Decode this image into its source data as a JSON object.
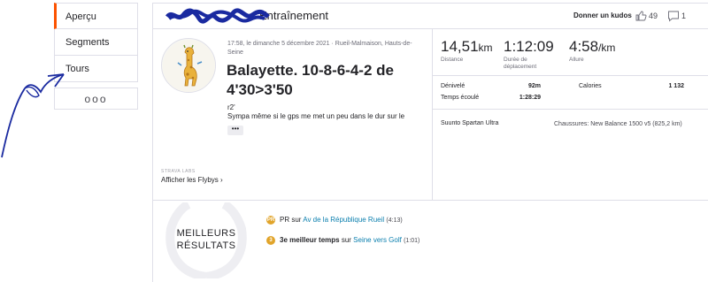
{
  "nav": {
    "items": [
      {
        "label": "Aperçu",
        "active": true
      },
      {
        "label": "Segments",
        "active": false
      },
      {
        "label": "Tours",
        "active": false
      }
    ],
    "more_label": "ooo"
  },
  "header": {
    "title": "Entraînement",
    "kudos_label": "Donner un kudos",
    "kudos_count": "49",
    "comment_count": "1"
  },
  "activity": {
    "meta": "17:58, le dimanche 5 décembre 2021 · Rueil-Malmaison, Hauts-de-Seine",
    "title": "Balayette. 10-8-6-4-2 de 4'30>3'50",
    "desc_line1": "r2'",
    "desc_line2": "Sympa même si le gps me met un peu dans le dur sur le",
    "more_btn": "•••",
    "labs_label": "STRAVA LABS",
    "flyby_label": "Afficher les Flybys ›"
  },
  "stats": {
    "distance": {
      "value": "14,51",
      "unit": "km",
      "label": "Distance"
    },
    "duration": {
      "value": "1:12:09",
      "label": "Durée de déplacement"
    },
    "pace": {
      "value": "4:58",
      "unit": "/km",
      "label": "Allure"
    },
    "elevation_label": "Dénivelé",
    "elevation_value": "92m",
    "elapsed_label": "Temps écoulé",
    "elapsed_value": "1:28:29",
    "calories_label": "Calories",
    "calories_value": "1 132",
    "device": "Suunto Spartan Ultra",
    "shoes": "Chaussures: New Balance 1500 v5 (825,2 km)"
  },
  "best": {
    "title": "MEILLEURS RÉSULTATS",
    "efforts": [
      {
        "medal": "PR",
        "prefix": "PR",
        "middle": " sur ",
        "link": "Av de la République Rueil",
        "time": "(4:13)"
      },
      {
        "medal": "3",
        "prefix": "3e meilleur temps",
        "middle": " sur ",
        "link": "Seine vers Golf",
        "time": "(1:01)"
      }
    ]
  },
  "colors": {
    "accent": "#fc5200",
    "link": "#0b7fae",
    "medal": "#e1a42a",
    "annotation": "#1a2aa0"
  }
}
